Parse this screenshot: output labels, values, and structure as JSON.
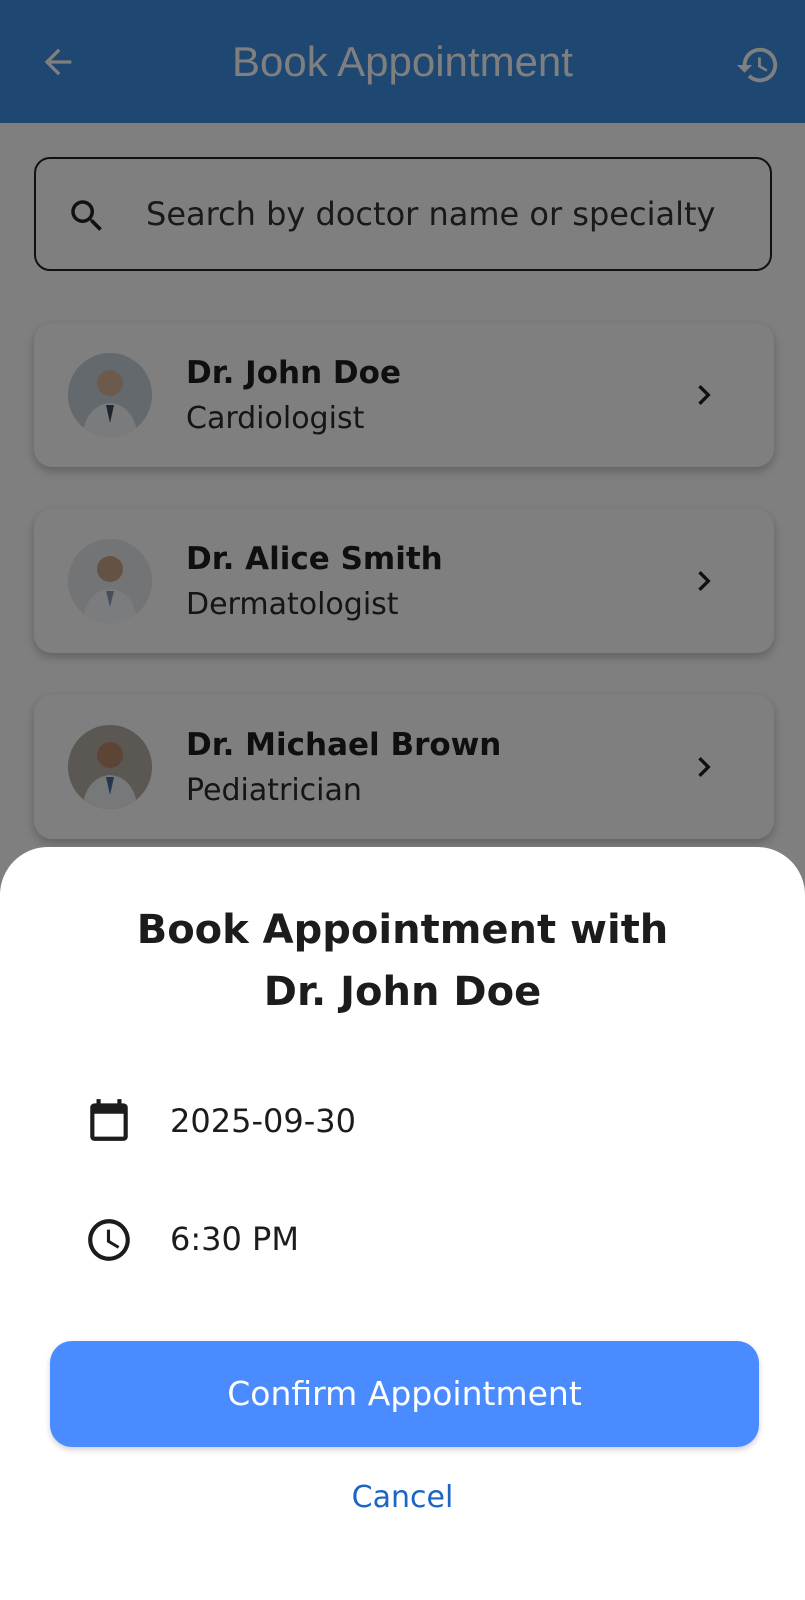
{
  "app_bar": {
    "title": "Book Appointment",
    "back_icon": "arrow-back-icon",
    "history_icon": "history-icon",
    "background": "#3d8fe3"
  },
  "search": {
    "placeholder": "Search by doctor name or specialty",
    "icon": "search-icon"
  },
  "doctors": [
    {
      "name": "Dr. John Doe",
      "specialty": "Cardiologist"
    },
    {
      "name": "Dr. Alice Smith",
      "specialty": "Dermatologist"
    },
    {
      "name": "Dr. Michael Brown",
      "specialty": "Pediatrician"
    }
  ],
  "sheet": {
    "title_line1": "Book Appointment with",
    "title_line2": "Dr. John Doe",
    "date": "2025-09-30",
    "date_icon": "calendar-icon",
    "time": "6:30 PM",
    "time_icon": "clock-icon",
    "confirm_label": "Confirm Appointment",
    "cancel_label": "Cancel",
    "accent": "#4a8cff",
    "link_color": "#1a66c4"
  }
}
